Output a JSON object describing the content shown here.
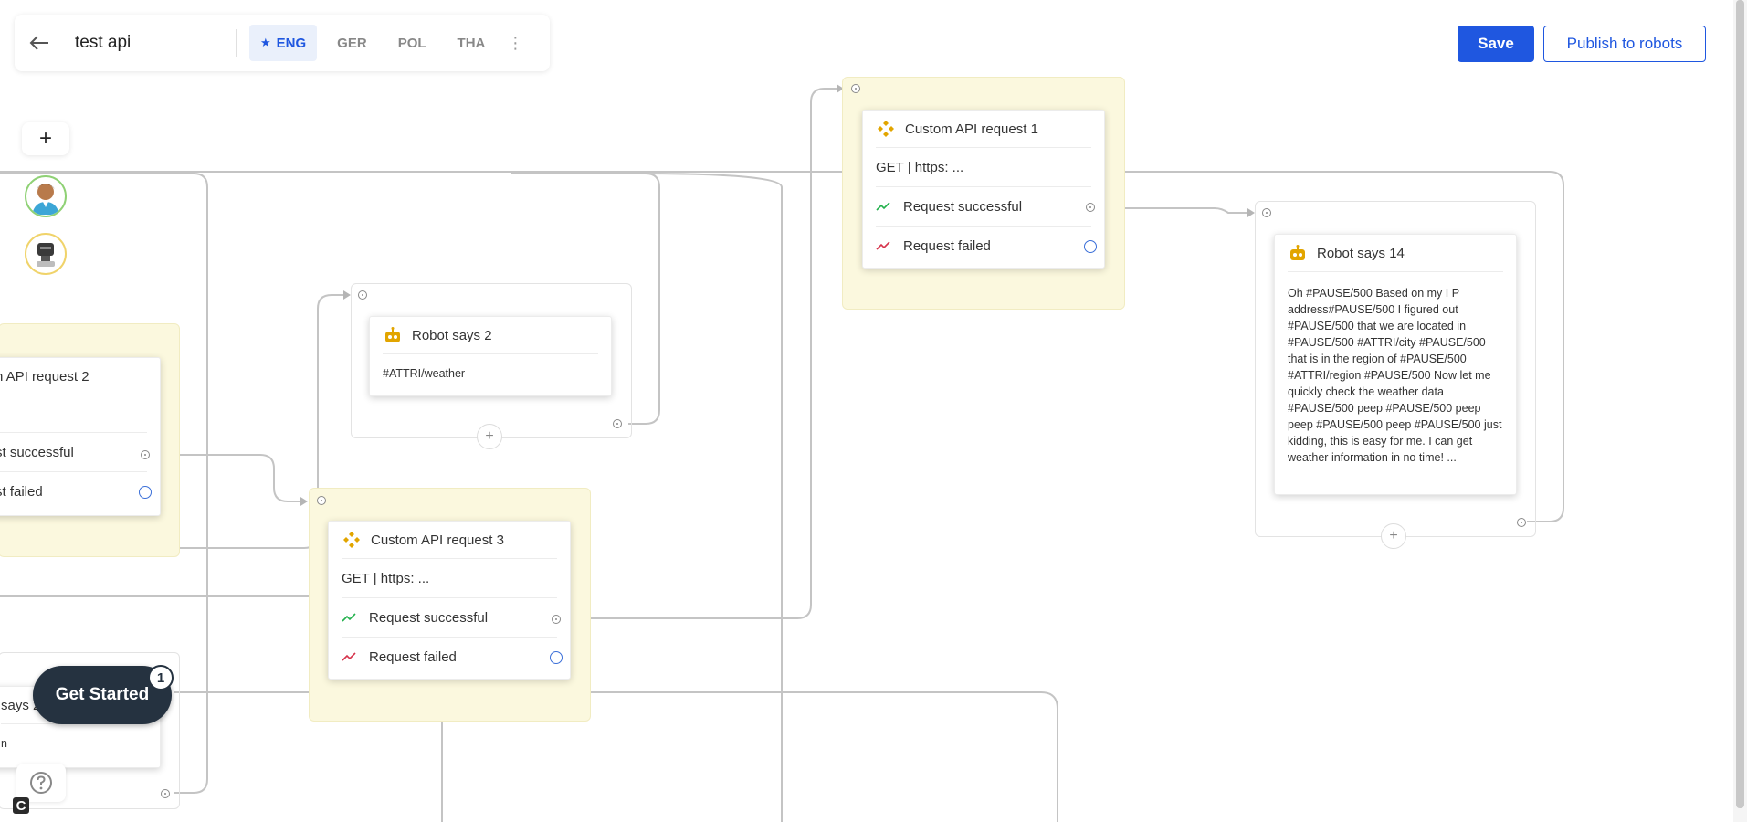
{
  "header": {
    "title": "test api",
    "langs": [
      {
        "code": "ENG",
        "active": true
      },
      {
        "code": "GER",
        "active": false
      },
      {
        "code": "POL",
        "active": false
      },
      {
        "code": "THA",
        "active": false
      }
    ],
    "save_label": "Save",
    "publish_label": "Publish to robots"
  },
  "colors": {
    "accent": "#1f57e0",
    "zone": "#fbf8de",
    "success": "#22b14c",
    "failed": "#d6334b",
    "api_icon": "#e2a500"
  },
  "nodes": {
    "api1": {
      "title": "Custom API request 1",
      "method": "GET | https: ...",
      "ok": "Request successful",
      "fail": "Request failed"
    },
    "api2": {
      "title": "n API request 2",
      "ok": "st successful",
      "fail": "st failed"
    },
    "api3": {
      "title": "Custom API request 3",
      "method": "GET | https: ...",
      "ok": "Request successful",
      "fail": "Request failed"
    },
    "robot2": {
      "title": "Robot says 2",
      "text": "#ATTRI/weather"
    },
    "robot14": {
      "title": "Robot says 14",
      "text": "Oh #PAUSE/500 Based on my I P address#PAUSE/500 I figured out #PAUSE/500 that we are located in #PAUSE/500 #ATTRI/city #PAUSE/500 that is in the region of #PAUSE/500 #ATTRI/region #PAUSE/500 Now let me quickly check the weather data #PAUSE/500 peep #PAUSE/500 peep peep #PAUSE/500 peep #PAUSE/500 just kidding, this is easy for me. I can get weather information in no time! ..."
    },
    "robotPartial": {
      "title": "says 2",
      "text": "n"
    }
  },
  "onboarding": {
    "get_started": "Get Started",
    "badge": "1"
  },
  "icons": {
    "back": "arrow-left-icon",
    "kebab": "more-vertical-icon",
    "plus": "plus-icon",
    "help": "question-icon"
  }
}
